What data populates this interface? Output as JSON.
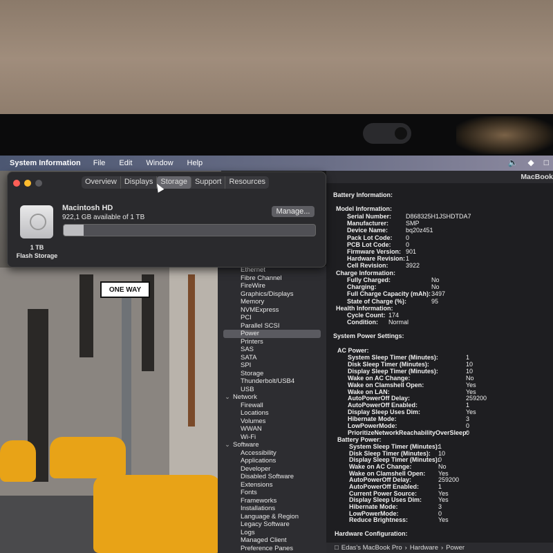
{
  "menubar": {
    "app": "System Information",
    "menus": [
      "File",
      "Edit",
      "Window",
      "Help"
    ],
    "status_icons": [
      "volume-icon",
      "wifi-icon",
      "display-icon"
    ]
  },
  "desktop": {
    "sign_text": "ONE WAY"
  },
  "about_window": {
    "tabs": [
      "Overview",
      "Displays",
      "Storage",
      "Support",
      "Resources"
    ],
    "active_tab": "Storage",
    "disk_name": "Macintosh HD",
    "disk_available": "922,1 GB available of 1 TB",
    "manage_label": "Manage...",
    "capacity_label": "1 TB",
    "storage_type": "Flash Storage",
    "used_fraction": 0.08
  },
  "main_window": {
    "title": "MacBook",
    "sidebar": [
      {
        "label": "Ethernet",
        "type": "item"
      },
      {
        "label": "Fibre Channel",
        "type": "item"
      },
      {
        "label": "FireWire",
        "type": "item"
      },
      {
        "label": "Graphics/Displays",
        "type": "item"
      },
      {
        "label": "Memory",
        "type": "item"
      },
      {
        "label": "NVMExpress",
        "type": "item"
      },
      {
        "label": "PCI",
        "type": "item"
      },
      {
        "label": "Parallel SCSI",
        "type": "item"
      },
      {
        "label": "Power",
        "type": "item",
        "selected": true
      },
      {
        "label": "Printers",
        "type": "item"
      },
      {
        "label": "SAS",
        "type": "item"
      },
      {
        "label": "SATA",
        "type": "item"
      },
      {
        "label": "SPI",
        "type": "item"
      },
      {
        "label": "Storage",
        "type": "item"
      },
      {
        "label": "Thunderbolt/USB4",
        "type": "item"
      },
      {
        "label": "USB",
        "type": "item"
      },
      {
        "label": "Network",
        "type": "group"
      },
      {
        "label": "Firewall",
        "type": "item"
      },
      {
        "label": "Locations",
        "type": "item"
      },
      {
        "label": "Volumes",
        "type": "item"
      },
      {
        "label": "WWAN",
        "type": "item"
      },
      {
        "label": "Wi-Fi",
        "type": "item"
      },
      {
        "label": "Software",
        "type": "group"
      },
      {
        "label": "Accessibility",
        "type": "item"
      },
      {
        "label": "Applications",
        "type": "item"
      },
      {
        "label": "Developer",
        "type": "item"
      },
      {
        "label": "Disabled Software",
        "type": "item"
      },
      {
        "label": "Extensions",
        "type": "item"
      },
      {
        "label": "Fonts",
        "type": "item"
      },
      {
        "label": "Frameworks",
        "type": "item"
      },
      {
        "label": "Installations",
        "type": "item"
      },
      {
        "label": "Language & Region",
        "type": "item"
      },
      {
        "label": "Legacy Software",
        "type": "item"
      },
      {
        "label": "Logs",
        "type": "item"
      },
      {
        "label": "Managed Client",
        "type": "item"
      },
      {
        "label": "Preference Panes",
        "type": "item"
      }
    ],
    "battery_info": {
      "heading": "Battery Information:",
      "model_heading": "Model Information:",
      "model": [
        [
          "Serial Number:",
          "D868325H1JSHDTDA7"
        ],
        [
          "Manufacturer:",
          "SMP"
        ],
        [
          "Device Name:",
          "bq20z451"
        ],
        [
          "Pack Lot Code:",
          "0"
        ],
        [
          "PCB Lot Code:",
          "0"
        ],
        [
          "Firmware Version:",
          "901"
        ],
        [
          "Hardware Revision:",
          "1"
        ],
        [
          "Cell Revision:",
          "3922"
        ]
      ],
      "charge_heading": "Charge Information:",
      "charge": [
        [
          "Fully Charged:",
          "No"
        ],
        [
          "Charging:",
          "No"
        ],
        [
          "Full Charge Capacity (mAh):",
          "3497"
        ],
        [
          "State of Charge (%):",
          "95"
        ]
      ],
      "health_heading": "Health Information:",
      "health": [
        [
          "Cycle Count:",
          "174"
        ],
        [
          "Condition:",
          "Normal"
        ]
      ]
    },
    "power_settings": {
      "heading": "System Power Settings:",
      "ac_heading": "AC Power:",
      "ac": [
        [
          "System Sleep Timer (Minutes):",
          "1"
        ],
        [
          "Disk Sleep Timer (Minutes):",
          "10"
        ],
        [
          "Display Sleep Timer (Minutes):",
          "10"
        ],
        [
          "Wake on AC Change:",
          "No"
        ],
        [
          "Wake on Clamshell Open:",
          "Yes"
        ],
        [
          "Wake on LAN:",
          "Yes"
        ],
        [
          "AutoPowerOff Delay:",
          "259200"
        ],
        [
          "AutoPowerOff Enabled:",
          "1"
        ],
        [
          "Display Sleep Uses Dim:",
          "Yes"
        ],
        [
          "Hibernate Mode:",
          "3"
        ],
        [
          "LowPowerMode:",
          "0"
        ],
        [
          "PrioritizeNetworkReachabilityOverSleep:",
          "0"
        ]
      ],
      "battery_heading": "Battery Power:",
      "battery": [
        [
          "System Sleep Timer (Minutes):",
          "1"
        ],
        [
          "Disk Sleep Timer (Minutes):",
          "10"
        ],
        [
          "Display Sleep Timer (Minutes):",
          "0"
        ],
        [
          "Wake on AC Change:",
          "No"
        ],
        [
          "Wake on Clamshell Open:",
          "Yes"
        ],
        [
          "AutoPowerOff Delay:",
          "259200"
        ],
        [
          "AutoPowerOff Enabled:",
          "1"
        ],
        [
          "Current Power Source:",
          "Yes"
        ],
        [
          "Display Sleep Uses Dim:",
          "Yes"
        ],
        [
          "Hibernate Mode:",
          "3"
        ],
        [
          "LowPowerMode:",
          "0"
        ],
        [
          "Reduce Brightness:",
          "Yes"
        ]
      ]
    },
    "hardware_heading": "Hardware Configuration:",
    "breadcrumb": [
      "Edas's MacBook Pro",
      "Hardware",
      "Power"
    ]
  }
}
